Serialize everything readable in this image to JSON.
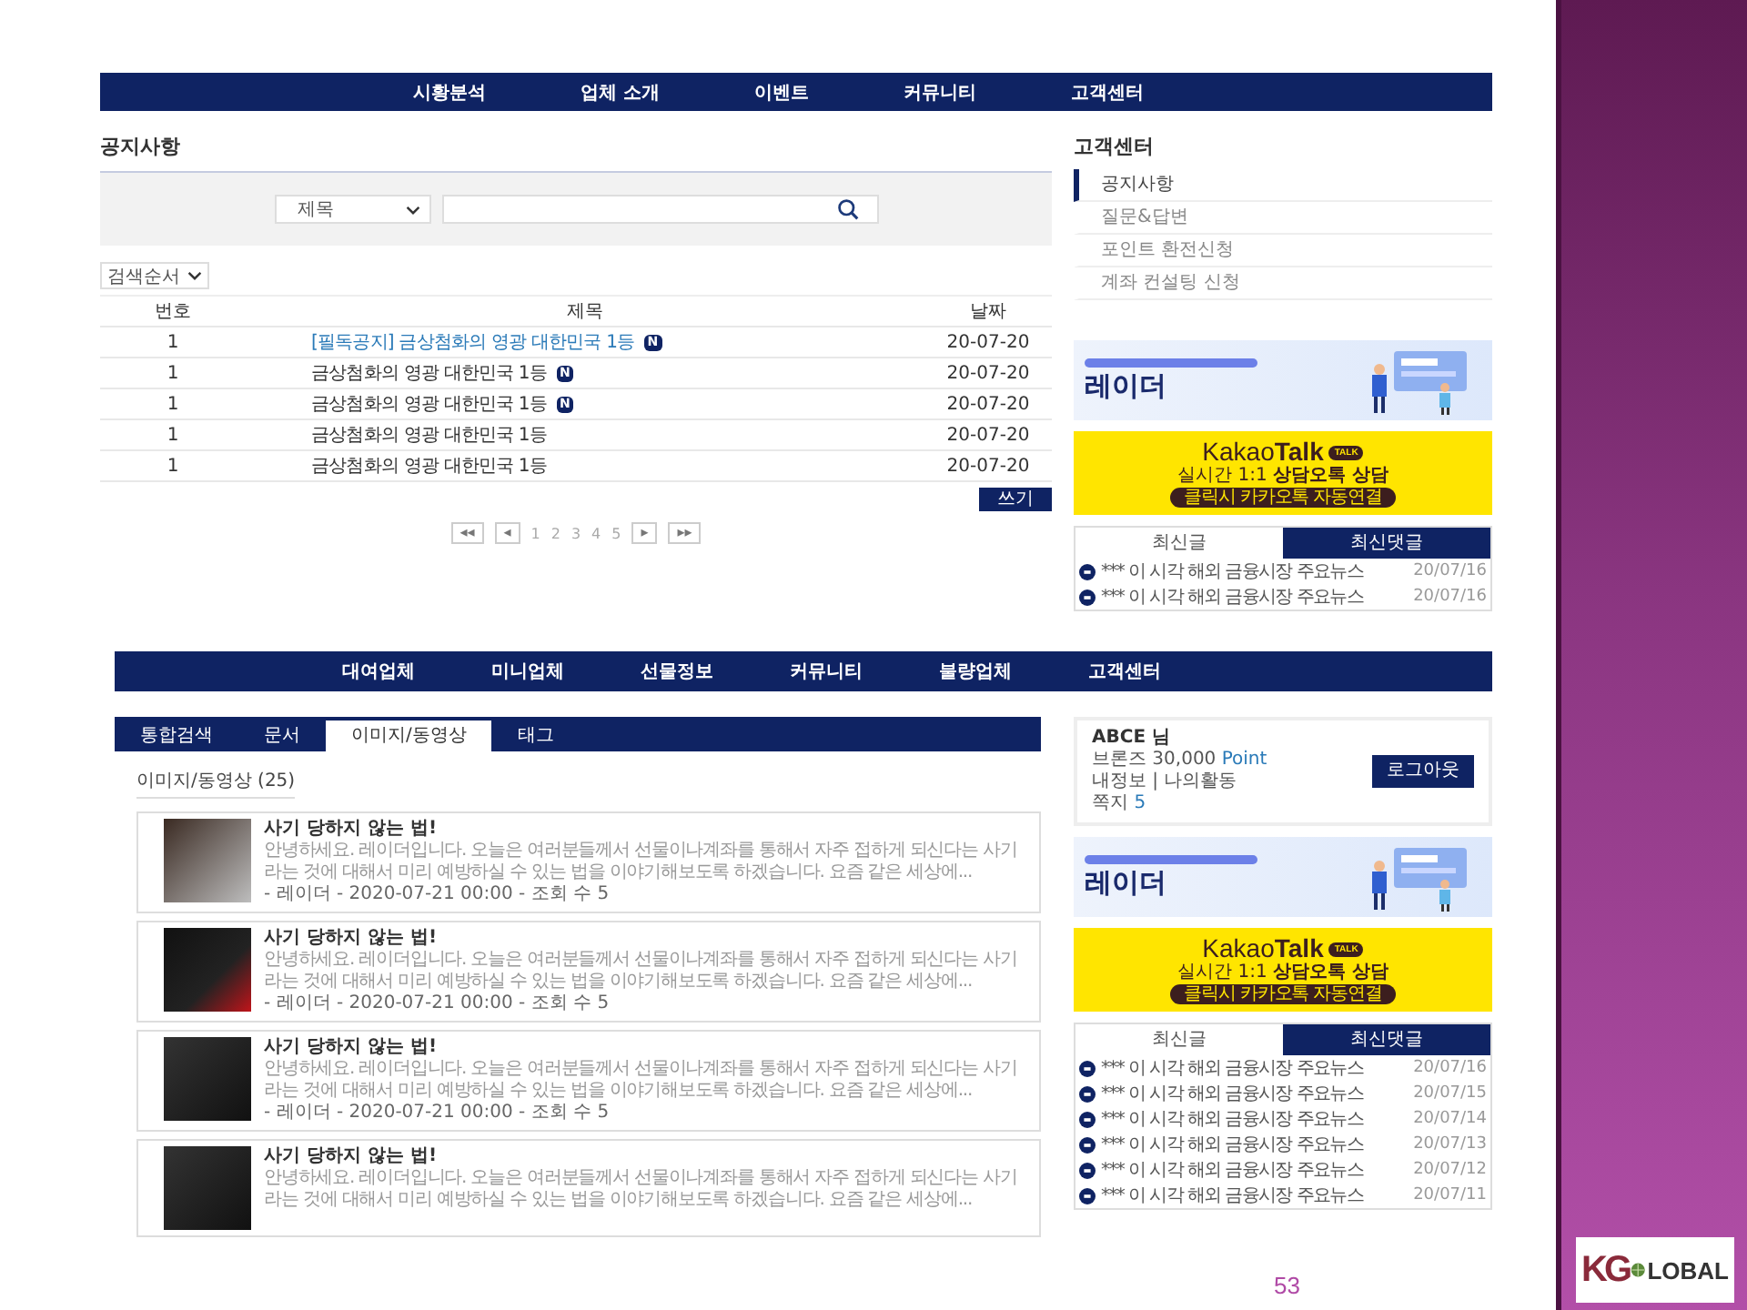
{
  "top_page": {
    "nav": [
      "시황분석",
      "업체 소개",
      "이벤트",
      "커뮤니티",
      "고객센터"
    ],
    "title": "공지사항",
    "search": {
      "field_select": "제목"
    },
    "sort_select": "검색순서",
    "table": {
      "columns": [
        "번호",
        "제목",
        "날짜"
      ],
      "rows": [
        {
          "no": "1",
          "title": "[필독공지] 금상첨화의 영광 대한민국 1등",
          "kind": "notice",
          "badge": "N",
          "date": "20-07-20"
        },
        {
          "no": "1",
          "title": "금상첨화의 영광 대한민국 1등",
          "kind": "normal",
          "badge": "N",
          "date": "20-07-20"
        },
        {
          "no": "1",
          "title": "금상첨화의 영광 대한민국 1등",
          "kind": "normal",
          "badge": "N",
          "date": "20-07-20"
        },
        {
          "no": "1",
          "title": "금상첨화의 영광 대한민국 1등",
          "kind": "normal",
          "date": "20-07-20"
        },
        {
          "no": "1",
          "title": "금상첨화의 영광 대한민국 1등",
          "kind": "normal",
          "date": "20-07-20"
        }
      ]
    },
    "write_button": "쓰기",
    "pagination": [
      {
        "label": "◂◂",
        "kind": "arrow"
      },
      {
        "label": "◂",
        "kind": "arrow"
      },
      {
        "label": "1",
        "kind": "page"
      },
      {
        "label": "2",
        "kind": "page"
      },
      {
        "label": "3",
        "kind": "page"
      },
      {
        "label": "4",
        "kind": "page"
      },
      {
        "label": "5",
        "kind": "page"
      },
      {
        "label": "▸",
        "kind": "arrow"
      },
      {
        "label": "▸▸",
        "kind": "arrow"
      }
    ],
    "sidebar": {
      "title": "고객센터",
      "items": [
        {
          "label": "공지사항",
          "selected": true
        },
        {
          "label": "질문&답변",
          "selected": false
        },
        {
          "label": "포인트 환전신청",
          "selected": false
        },
        {
          "label": "계좌 컨설팅 신청",
          "selected": false
        }
      ]
    },
    "radar_banner": {
      "title": "레이더"
    },
    "kakao_banner": {
      "brand": "Kakao**Talk**",
      "bubble": "TALK",
      "line": "실시간 1:1 **상담오톡 상담**",
      "button": "클릭시 카카오톡 자동연결"
    },
    "latest": {
      "tabs": [
        {
          "label": "최신글",
          "selected": true
        },
        {
          "label": "최신댓글",
          "selected": false
        }
      ],
      "items": [
        {
          "title": "*** 이 시각 해외 금융시장 주요뉴스",
          "date": "20/07/16"
        },
        {
          "title": "*** 이 시각 해외 금융시장 주요뉴스",
          "date": "20/07/16"
        }
      ]
    }
  },
  "bottom_page": {
    "nav": [
      "대여업체",
      "미니업체",
      "선물정보",
      "커뮤니티",
      "불량업체",
      "고객센터"
    ],
    "tabs": [
      {
        "label": "통합검색",
        "selected": false
      },
      {
        "label": "문서",
        "selected": false
      },
      {
        "label": "이미지/동영상",
        "selected": true
      },
      {
        "label": "태그",
        "selected": false
      }
    ],
    "heading": "이미지/동영상 (25)",
    "cards": [
      {
        "title": "사기 당하지 않는 법!",
        "excerpt": "안녕하세요. 레이더입니다. 오늘은 여러분들께서 선물이나계좌를 통해서 자주 접하게 되신다는 사기라는 것에 대해서 미리 예방하실 수 있는 법을 이야기해보도록 하겠습니다. 요즘 같은 세상에...",
        "meta": "- 레이더 - 2020-07-21 00:00 - 조회 수 5"
      },
      {
        "title": "사기 당하지 않는 법!",
        "excerpt": "안녕하세요. 레이더입니다. 오늘은 여러분들께서 선물이나계좌를 통해서 자주 접하게 되신다는 사기라는 것에 대해서 미리 예방하실 수 있는 법을 이야기해보도록 하겠습니다. 요즘 같은 세상에...",
        "meta": "- 레이더 - 2020-07-21 00:00 - 조회 수 5"
      },
      {
        "title": "사기 당하지 않는 법!",
        "excerpt": "안녕하세요. 레이더입니다. 오늘은 여러분들께서 선물이나계좌를 통해서 자주 접하게 되신다는 사기라는 것에 대해서 미리 예방하실 수 있는 법을 이야기해보도록 하겠습니다. 요즘 같은 세상에...",
        "meta": "- 레이더 - 2020-07-21 00:00 - 조회 수 5"
      },
      {
        "title": "사기 당하지 않는 법!",
        "excerpt": "안녕하세요. 레이더입니다. 오늘은 여러분들께서 선물이나계좌를 통해서 자주 접하게 되신다는 사기라는 것에 대해서 미리 예방하실 수 있는 법을 이야기해보도록 하겠습니다. 요즘 같은 세상에..."
      }
    ],
    "user_box": {
      "name": "ABCE 님",
      "level": "브론즈",
      "points": "30,000",
      "unit": "Point",
      "links": "내정보 | 나의활동",
      "messages_label": "쪽지",
      "messages_count": "5",
      "logout": "로그아웃"
    },
    "radar_banner": {
      "title": "레이더"
    },
    "kakao_banner": {
      "brand": "Kakao**Talk**",
      "bubble": "TALK",
      "line": "실시간 1:1 **상담오톡 상담**",
      "button": "클릭시 카카오톡 자동연결"
    },
    "latest": {
      "tabs": [
        {
          "label": "최신글",
          "selected": true
        },
        {
          "label": "최신댓글",
          "selected": false
        }
      ],
      "items": [
        {
          "title": "*** 이 시각 해외 금융시장 주요뉴스",
          "date": "20/07/16"
        },
        {
          "title": "*** 이 시각 해외 금융시장 주요뉴스",
          "date": "20/07/15"
        },
        {
          "title": "*** 이 시각 해외 금융시장 주요뉴스",
          "date": "20/07/14"
        },
        {
          "title": "*** 이 시각 해외 금융시장 주요뉴스",
          "date": "20/07/13"
        },
        {
          "title": "*** 이 시각 해외 금융시장 주요뉴스",
          "date": "20/07/12"
        },
        {
          "title": "*** 이 시각 해외 금융시장 주요뉴스",
          "date": "20/07/11"
        }
      ]
    }
  },
  "slide": {
    "page_number": "53",
    "logo": {
      "mark": "KG",
      "word": "LOBAL"
    }
  }
}
